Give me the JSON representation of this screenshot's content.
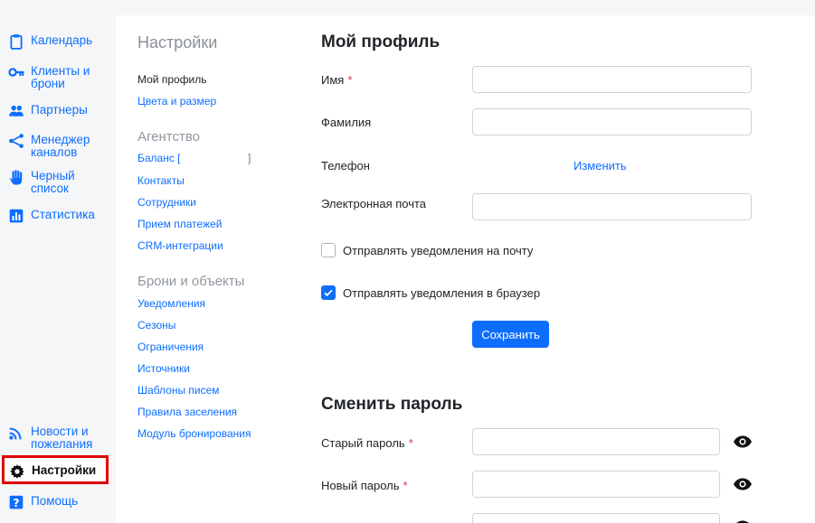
{
  "sidebar": {
    "items": [
      {
        "label": "Календарь",
        "icon": "clipboard-icon"
      },
      {
        "label": "Клиенты и брони",
        "icon": "key-icon"
      },
      {
        "label": "Партнеры",
        "icon": "people-icon"
      },
      {
        "label": "Менеджер каналов",
        "icon": "share-icon"
      },
      {
        "label": "Черный список",
        "icon": "hand-icon"
      },
      {
        "label": "Статистика",
        "icon": "bar-chart-icon"
      }
    ],
    "bottom": [
      {
        "label": "Новости и пожелания",
        "icon": "wifi-icon"
      },
      {
        "label": "Настройки",
        "icon": "gear-icon"
      },
      {
        "label": "Помощь",
        "icon": "question-icon"
      }
    ]
  },
  "settings_menu": {
    "title": "Настройки",
    "items": [
      "Мой профиль",
      "Цвета и размер"
    ],
    "agency_title": "Агентство",
    "agency_items": [
      "Баланс [",
      "Контакты",
      "Сотрудники",
      "Прием платежей",
      "CRM-интеграции"
    ],
    "balance_close": "]",
    "objects_title": "Брони и объекты",
    "objects_items": [
      "Уведомления",
      "Сезоны",
      "Ограничения",
      "Источники",
      "Шаблоны писем",
      "Правила заселения",
      "Модуль бронирования"
    ]
  },
  "profile": {
    "title": "Мой профиль",
    "first_name_label": "Имя",
    "last_name_label": "Фамилия",
    "phone_label": "Телефон",
    "phone_change": "Изменить",
    "email_label": "Электронная почта",
    "required_mark": "*",
    "notify_email": "Отправлять уведомления на почту",
    "notify_email_checked": false,
    "notify_browser": "Отправлять уведомления в браузер",
    "notify_browser_checked": true,
    "save": "Сохранить"
  },
  "password": {
    "title": "Сменить пароль",
    "old_label": "Старый пароль",
    "new_label": "Новый пароль"
  },
  "colors": {
    "accent": "#0d6efd",
    "highlight_border": "#e00000",
    "sidebar_bg": "#f5f6f8"
  }
}
